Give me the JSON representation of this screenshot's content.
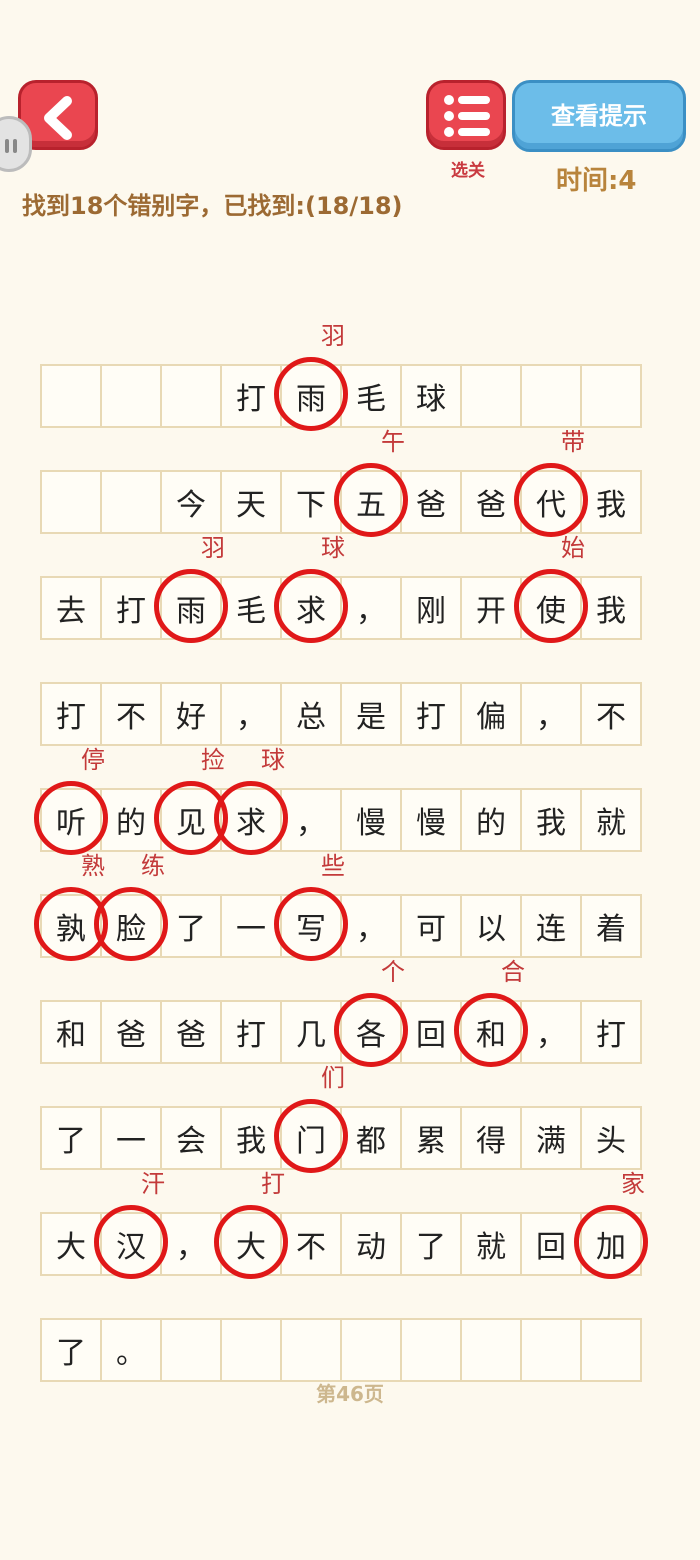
{
  "header": {
    "levels_label": "选关",
    "hint_label": "查看提示",
    "timer": "时间:4",
    "progress": "找到18个错别字，已找到:(18/18)"
  },
  "grid": [
    [
      "",
      "",
      "",
      "打",
      "雨",
      "毛",
      "球",
      "",
      "",
      ""
    ],
    [
      "",
      "",
      "今",
      "天",
      "下",
      "五",
      "爸",
      "爸",
      "代",
      "我"
    ],
    [
      "去",
      "打",
      "雨",
      "毛",
      "求",
      "，",
      "刚",
      "开",
      "使",
      "我"
    ],
    [
      "打",
      "不",
      "好",
      "，",
      "总",
      "是",
      "打",
      "偏",
      "，",
      "不"
    ],
    [
      "听",
      "的",
      "见",
      "求",
      "，",
      "慢",
      "慢",
      "的",
      "我",
      "就"
    ],
    [
      "孰",
      "脸",
      "了",
      "一",
      "写",
      "，",
      "可",
      "以",
      "连",
      "着"
    ],
    [
      "和",
      "爸",
      "爸",
      "打",
      "几",
      "各",
      "回",
      "和",
      "，",
      "打"
    ],
    [
      "了",
      "一",
      "会",
      "我",
      "门",
      "都",
      "累",
      "得",
      "满",
      "头"
    ],
    [
      "大",
      "汉",
      "，",
      "大",
      "不",
      "动",
      "了",
      "就",
      "回",
      "加"
    ],
    [
      "了",
      "。",
      "",
      "",
      "",
      "",
      "",
      "",
      "",
      ""
    ]
  ],
  "corrections": [
    {
      "row": 0,
      "col": 4,
      "text": "羽"
    },
    {
      "row": 1,
      "col": 5,
      "text": "午"
    },
    {
      "row": 1,
      "col": 8,
      "text": "带"
    },
    {
      "row": 2,
      "col": 2,
      "text": "羽"
    },
    {
      "row": 2,
      "col": 4,
      "text": "球"
    },
    {
      "row": 2,
      "col": 8,
      "text": "始"
    },
    {
      "row": 4,
      "col": 0,
      "text": "停"
    },
    {
      "row": 4,
      "col": 2,
      "text": "捡"
    },
    {
      "row": 4,
      "col": 3,
      "text": "球"
    },
    {
      "row": 5,
      "col": 0,
      "text": "熟"
    },
    {
      "row": 5,
      "col": 1,
      "text": "练"
    },
    {
      "row": 5,
      "col": 4,
      "text": "些"
    },
    {
      "row": 6,
      "col": 5,
      "text": "个"
    },
    {
      "row": 6,
      "col": 7,
      "text": "合"
    },
    {
      "row": 7,
      "col": 4,
      "text": "们"
    },
    {
      "row": 8,
      "col": 1,
      "text": "汗"
    },
    {
      "row": 8,
      "col": 3,
      "text": "打"
    },
    {
      "row": 8,
      "col": 9,
      "text": "家"
    }
  ],
  "page_label": "第46页",
  "colors": {
    "circle": "#e01818",
    "correction": "#c33a3a",
    "button_red": "#ea4650",
    "button_blue": "#6cbde9"
  },
  "icons": {
    "back": "chevron-left-icon",
    "levels": "list-icon"
  }
}
